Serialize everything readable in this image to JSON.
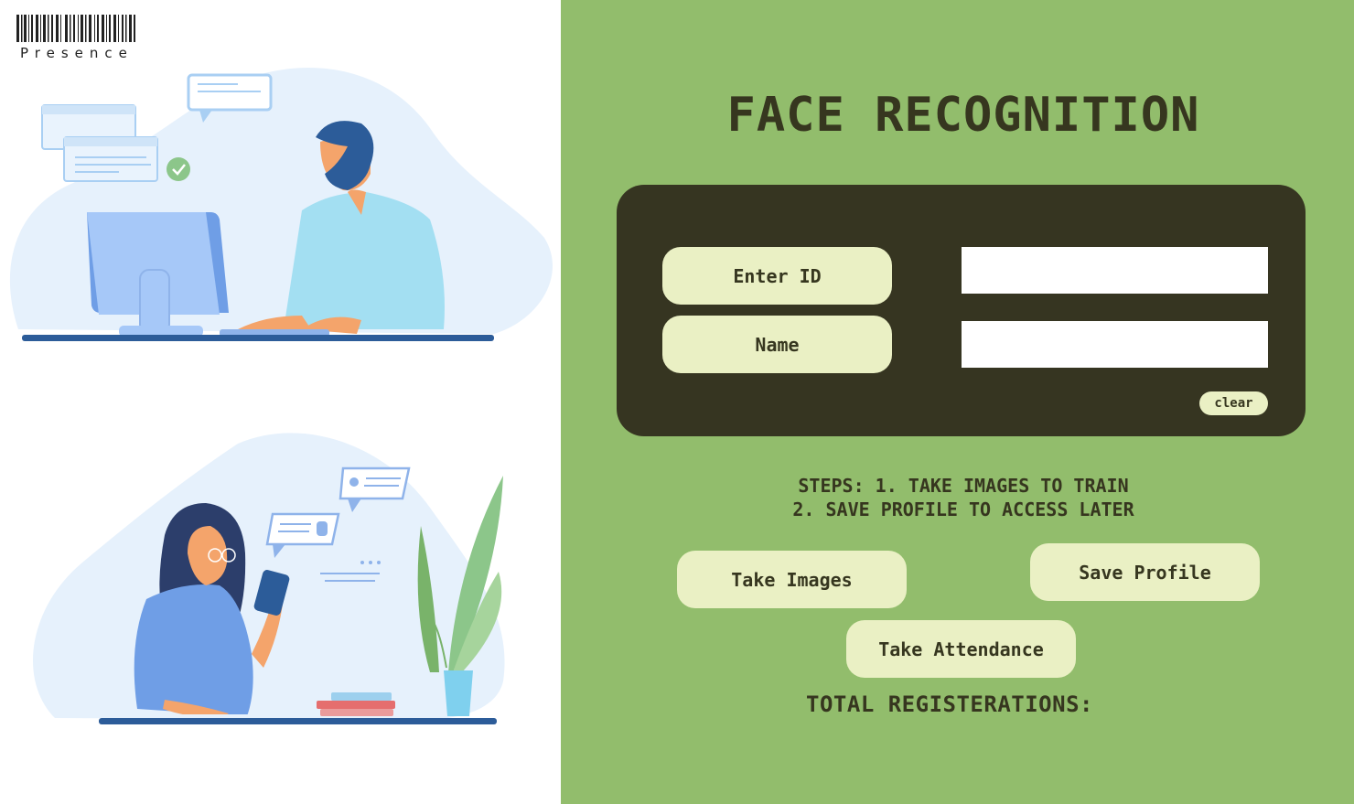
{
  "brand": {
    "name": "Presence"
  },
  "header": {
    "title": "FACE RECOGNITION"
  },
  "form": {
    "id_label": "Enter ID",
    "id_value": "",
    "name_label": "Name",
    "name_value": "",
    "clear_label": "clear"
  },
  "steps": {
    "line1": "STEPS: 1. TAKE IMAGES TO TRAIN",
    "line2": "2. SAVE PROFILE TO ACCESS LATER"
  },
  "actions": {
    "take_images": "Take Images",
    "save_profile": "Save Profile",
    "take_attendance": "Take Attendance"
  },
  "stats": {
    "total_label": "TOTAL REGISTERATIONS:"
  },
  "colors": {
    "panel_bg": "#92bd6c",
    "form_bg": "#363521",
    "button_bg": "#eaf0c4",
    "text_dark": "#36361f"
  }
}
